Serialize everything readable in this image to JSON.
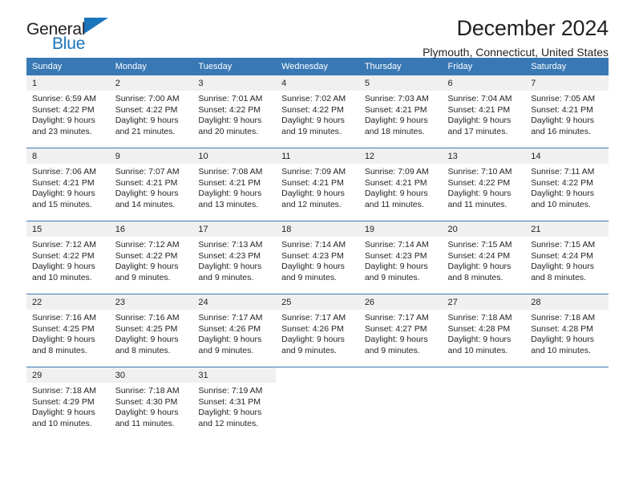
{
  "logo": {
    "word1": "General",
    "word2": "Blue",
    "triangle_color": "#1b75bb"
  },
  "header": {
    "title": "December 2024",
    "subtitle": "Plymouth, Connecticut, United States"
  },
  "colors": {
    "header_blue": "#3878b5",
    "daynum_band": "#f0f0f0",
    "text": "#231f20"
  },
  "weekday_headers": [
    "Sunday",
    "Monday",
    "Tuesday",
    "Wednesday",
    "Thursday",
    "Friday",
    "Saturday"
  ],
  "weeks": [
    [
      {
        "day": "1",
        "sunrise": "Sunrise: 6:59 AM",
        "sunset": "Sunset: 4:22 PM",
        "daylight_line1": "Daylight: 9 hours",
        "daylight_line2": "and 23 minutes."
      },
      {
        "day": "2",
        "sunrise": "Sunrise: 7:00 AM",
        "sunset": "Sunset: 4:22 PM",
        "daylight_line1": "Daylight: 9 hours",
        "daylight_line2": "and 21 minutes."
      },
      {
        "day": "3",
        "sunrise": "Sunrise: 7:01 AM",
        "sunset": "Sunset: 4:22 PM",
        "daylight_line1": "Daylight: 9 hours",
        "daylight_line2": "and 20 minutes."
      },
      {
        "day": "4",
        "sunrise": "Sunrise: 7:02 AM",
        "sunset": "Sunset: 4:22 PM",
        "daylight_line1": "Daylight: 9 hours",
        "daylight_line2": "and 19 minutes."
      },
      {
        "day": "5",
        "sunrise": "Sunrise: 7:03 AM",
        "sunset": "Sunset: 4:21 PM",
        "daylight_line1": "Daylight: 9 hours",
        "daylight_line2": "and 18 minutes."
      },
      {
        "day": "6",
        "sunrise": "Sunrise: 7:04 AM",
        "sunset": "Sunset: 4:21 PM",
        "daylight_line1": "Daylight: 9 hours",
        "daylight_line2": "and 17 minutes."
      },
      {
        "day": "7",
        "sunrise": "Sunrise: 7:05 AM",
        "sunset": "Sunset: 4:21 PM",
        "daylight_line1": "Daylight: 9 hours",
        "daylight_line2": "and 16 minutes."
      }
    ],
    [
      {
        "day": "8",
        "sunrise": "Sunrise: 7:06 AM",
        "sunset": "Sunset: 4:21 PM",
        "daylight_line1": "Daylight: 9 hours",
        "daylight_line2": "and 15 minutes."
      },
      {
        "day": "9",
        "sunrise": "Sunrise: 7:07 AM",
        "sunset": "Sunset: 4:21 PM",
        "daylight_line1": "Daylight: 9 hours",
        "daylight_line2": "and 14 minutes."
      },
      {
        "day": "10",
        "sunrise": "Sunrise: 7:08 AM",
        "sunset": "Sunset: 4:21 PM",
        "daylight_line1": "Daylight: 9 hours",
        "daylight_line2": "and 13 minutes."
      },
      {
        "day": "11",
        "sunrise": "Sunrise: 7:09 AM",
        "sunset": "Sunset: 4:21 PM",
        "daylight_line1": "Daylight: 9 hours",
        "daylight_line2": "and 12 minutes."
      },
      {
        "day": "12",
        "sunrise": "Sunrise: 7:09 AM",
        "sunset": "Sunset: 4:21 PM",
        "daylight_line1": "Daylight: 9 hours",
        "daylight_line2": "and 11 minutes."
      },
      {
        "day": "13",
        "sunrise": "Sunrise: 7:10 AM",
        "sunset": "Sunset: 4:22 PM",
        "daylight_line1": "Daylight: 9 hours",
        "daylight_line2": "and 11 minutes."
      },
      {
        "day": "14",
        "sunrise": "Sunrise: 7:11 AM",
        "sunset": "Sunset: 4:22 PM",
        "daylight_line1": "Daylight: 9 hours",
        "daylight_line2": "and 10 minutes."
      }
    ],
    [
      {
        "day": "15",
        "sunrise": "Sunrise: 7:12 AM",
        "sunset": "Sunset: 4:22 PM",
        "daylight_line1": "Daylight: 9 hours",
        "daylight_line2": "and 10 minutes."
      },
      {
        "day": "16",
        "sunrise": "Sunrise: 7:12 AM",
        "sunset": "Sunset: 4:22 PM",
        "daylight_line1": "Daylight: 9 hours",
        "daylight_line2": "and 9 minutes."
      },
      {
        "day": "17",
        "sunrise": "Sunrise: 7:13 AM",
        "sunset": "Sunset: 4:23 PM",
        "daylight_line1": "Daylight: 9 hours",
        "daylight_line2": "and 9 minutes."
      },
      {
        "day": "18",
        "sunrise": "Sunrise: 7:14 AM",
        "sunset": "Sunset: 4:23 PM",
        "daylight_line1": "Daylight: 9 hours",
        "daylight_line2": "and 9 minutes."
      },
      {
        "day": "19",
        "sunrise": "Sunrise: 7:14 AM",
        "sunset": "Sunset: 4:23 PM",
        "daylight_line1": "Daylight: 9 hours",
        "daylight_line2": "and 9 minutes."
      },
      {
        "day": "20",
        "sunrise": "Sunrise: 7:15 AM",
        "sunset": "Sunset: 4:24 PM",
        "daylight_line1": "Daylight: 9 hours",
        "daylight_line2": "and 8 minutes."
      },
      {
        "day": "21",
        "sunrise": "Sunrise: 7:15 AM",
        "sunset": "Sunset: 4:24 PM",
        "daylight_line1": "Daylight: 9 hours",
        "daylight_line2": "and 8 minutes."
      }
    ],
    [
      {
        "day": "22",
        "sunrise": "Sunrise: 7:16 AM",
        "sunset": "Sunset: 4:25 PM",
        "daylight_line1": "Daylight: 9 hours",
        "daylight_line2": "and 8 minutes."
      },
      {
        "day": "23",
        "sunrise": "Sunrise: 7:16 AM",
        "sunset": "Sunset: 4:25 PM",
        "daylight_line1": "Daylight: 9 hours",
        "daylight_line2": "and 8 minutes."
      },
      {
        "day": "24",
        "sunrise": "Sunrise: 7:17 AM",
        "sunset": "Sunset: 4:26 PM",
        "daylight_line1": "Daylight: 9 hours",
        "daylight_line2": "and 9 minutes."
      },
      {
        "day": "25",
        "sunrise": "Sunrise: 7:17 AM",
        "sunset": "Sunset: 4:26 PM",
        "daylight_line1": "Daylight: 9 hours",
        "daylight_line2": "and 9 minutes."
      },
      {
        "day": "26",
        "sunrise": "Sunrise: 7:17 AM",
        "sunset": "Sunset: 4:27 PM",
        "daylight_line1": "Daylight: 9 hours",
        "daylight_line2": "and 9 minutes."
      },
      {
        "day": "27",
        "sunrise": "Sunrise: 7:18 AM",
        "sunset": "Sunset: 4:28 PM",
        "daylight_line1": "Daylight: 9 hours",
        "daylight_line2": "and 10 minutes."
      },
      {
        "day": "28",
        "sunrise": "Sunrise: 7:18 AM",
        "sunset": "Sunset: 4:28 PM",
        "daylight_line1": "Daylight: 9 hours",
        "daylight_line2": "and 10 minutes."
      }
    ],
    [
      {
        "day": "29",
        "sunrise": "Sunrise: 7:18 AM",
        "sunset": "Sunset: 4:29 PM",
        "daylight_line1": "Daylight: 9 hours",
        "daylight_line2": "and 10 minutes."
      },
      {
        "day": "30",
        "sunrise": "Sunrise: 7:18 AM",
        "sunset": "Sunset: 4:30 PM",
        "daylight_line1": "Daylight: 9 hours",
        "daylight_line2": "and 11 minutes."
      },
      {
        "day": "31",
        "sunrise": "Sunrise: 7:19 AM",
        "sunset": "Sunset: 4:31 PM",
        "daylight_line1": "Daylight: 9 hours",
        "daylight_line2": "and 12 minutes."
      },
      {
        "day": "",
        "sunrise": "",
        "sunset": "",
        "daylight_line1": "",
        "daylight_line2": ""
      },
      {
        "day": "",
        "sunrise": "",
        "sunset": "",
        "daylight_line1": "",
        "daylight_line2": ""
      },
      {
        "day": "",
        "sunrise": "",
        "sunset": "",
        "daylight_line1": "",
        "daylight_line2": ""
      },
      {
        "day": "",
        "sunrise": "",
        "sunset": "",
        "daylight_line1": "",
        "daylight_line2": ""
      }
    ]
  ]
}
